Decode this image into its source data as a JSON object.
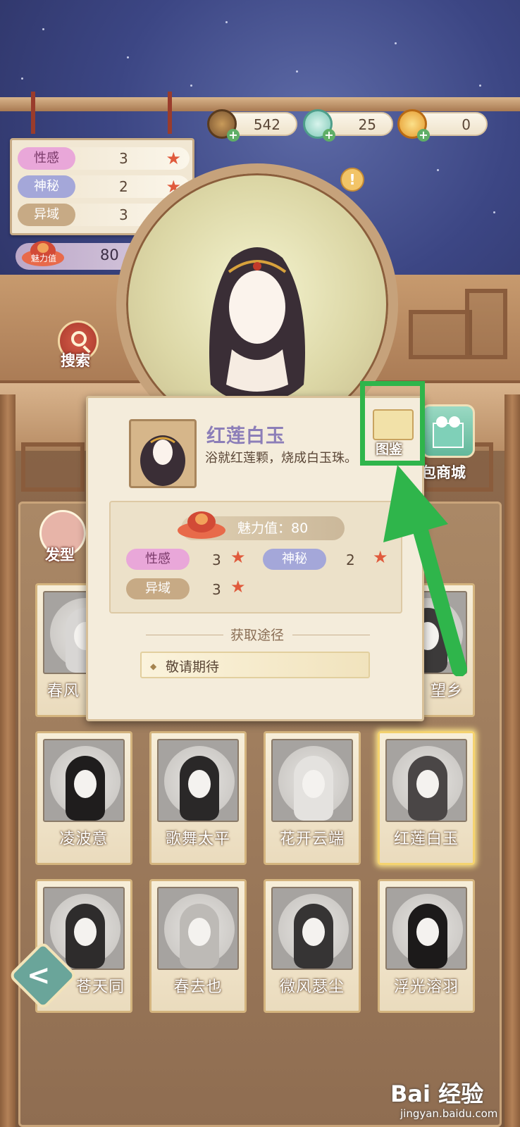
{
  "currency": [
    {
      "icon": "coin-icon",
      "value": "542"
    },
    {
      "icon": "jade-icon",
      "value": "25"
    },
    {
      "icon": "gold-ingot-icon",
      "value": "0"
    }
  ],
  "attributes": [
    {
      "label": "性感",
      "value": "3"
    },
    {
      "label": "神秘",
      "value": "2"
    },
    {
      "label": "异域",
      "value": "3"
    }
  ],
  "charm": {
    "label": "魅力值",
    "value": "80"
  },
  "search": {
    "label": "搜索"
  },
  "popup": {
    "title": "红莲白玉",
    "description": "浴就红莲颗，烧成白玉珠。",
    "codex_label": "图鉴",
    "charm_text": "魅力值：80",
    "attributes": [
      {
        "label": "性感",
        "value": "3"
      },
      {
        "label": "神秘",
        "value": "2"
      },
      {
        "label": "异域",
        "value": "3"
      }
    ],
    "source_title": "获取途径",
    "source_item": "敬请期待"
  },
  "side": {
    "shop_label": "包商城",
    "hair_tab": "发型"
  },
  "cards_row1_partial": [
    "春风",
    "望乡"
  ],
  "cards": [
    "凌波意",
    "歌舞太平",
    "花开云端",
    "红莲白玉",
    "苍天同",
    "春去也",
    "微风瑟尘",
    "浮光溶羽"
  ],
  "selected_card": "红莲白玉",
  "colors": {
    "highlight": "#2fb54b",
    "star": "#e05a3c",
    "title": "#8c7eb8"
  },
  "watermark": {
    "brand": "Bai 经验",
    "url": "jingyan.baidu.com"
  }
}
